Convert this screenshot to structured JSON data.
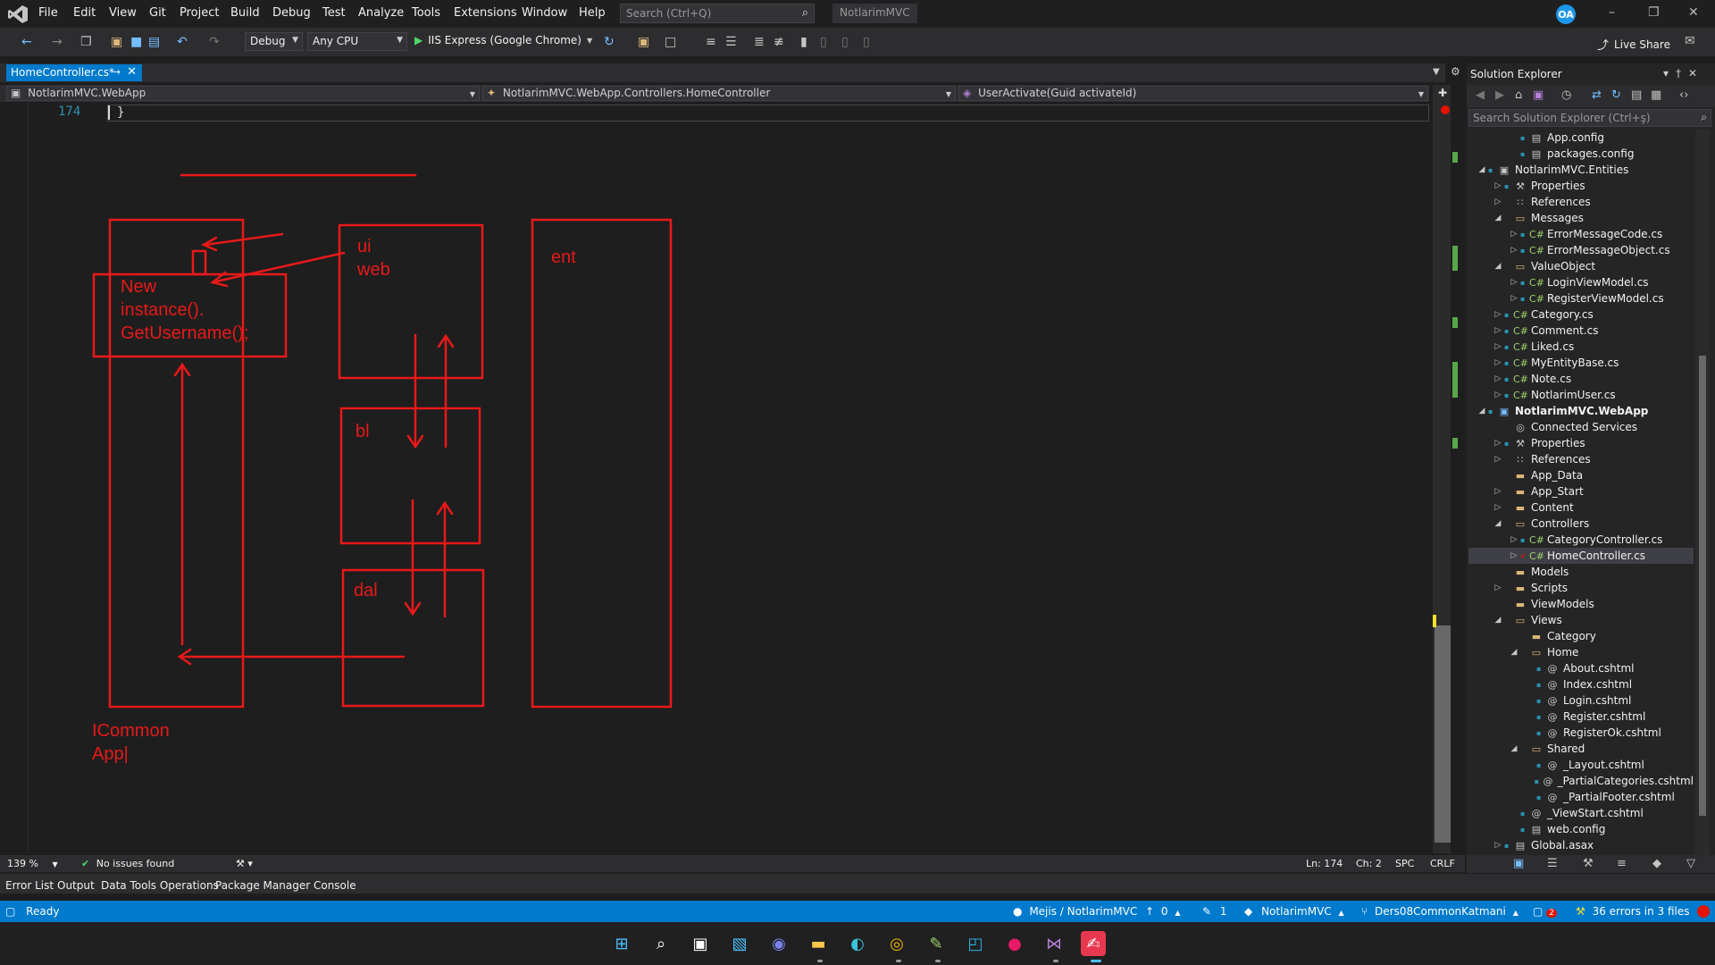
{
  "titlebar": {
    "menu": [
      "File",
      "Edit",
      "View",
      "Git",
      "Project",
      "Build",
      "Debug",
      "Test",
      "Analyze",
      "Tools",
      "Extensions",
      "Window",
      "Help"
    ],
    "search_placeholder": "Search (Ctrl+Q)",
    "solution_name": "NotlarimMVC",
    "avatar_initials": "OA"
  },
  "toolbar": {
    "configuration": "Debug",
    "platform": "Any CPU",
    "run_target": "IIS Express (Google Chrome)",
    "live_share": "Live Share"
  },
  "document_tab": {
    "label": "HomeController.cs*"
  },
  "navbar": {
    "project": "NotlarimMVC.WebApp",
    "type": "NotlarimMVC.WebApp.Controllers.HomeController",
    "member": "UserActivate(Guid activateId)"
  },
  "editor": {
    "line_number": "174",
    "code": "}"
  },
  "drawing": {
    "labels": {
      "ui": "ui",
      "web": "web",
      "ent": "ent",
      "bl": "bl",
      "dal": "dal",
      "new_line1": "New",
      "new_line2": "instance().",
      "new_line3": "GetUsername();",
      "common_line1": "ICommon",
      "common_line2": "App|"
    },
    "ink_color": "#e81919"
  },
  "solution_explorer": {
    "title": "Solution Explorer",
    "search_placeholder": "Search Solution Explorer (Ctrl+ş)",
    "items": [
      {
        "label": "App.config",
        "indent": 2,
        "expander": "",
        "icon": "config",
        "lock": true
      },
      {
        "label": "packages.config",
        "indent": 2,
        "expander": "",
        "icon": "config",
        "lock": true
      },
      {
        "label": "NotlarimMVC.Entities",
        "indent": 0,
        "expander": "open",
        "icon": "project",
        "lock": true
      },
      {
        "label": "Properties",
        "indent": 1,
        "expander": "closed",
        "icon": "wrench",
        "lock": true
      },
      {
        "label": "References",
        "indent": 1,
        "expander": "closed",
        "icon": "references",
        "lock": false
      },
      {
        "label": "Messages",
        "indent": 1,
        "expander": "open",
        "icon": "folder-open",
        "lock": false
      },
      {
        "label": "ErrorMessageCode.cs",
        "indent": 2,
        "expander": "closed",
        "icon": "csharp",
        "lock": true
      },
      {
        "label": "ErrorMessageObject.cs",
        "indent": 2,
        "expander": "closed",
        "icon": "csharp",
        "lock": true
      },
      {
        "label": "ValueObject",
        "indent": 1,
        "expander": "open",
        "icon": "folder-open",
        "lock": false
      },
      {
        "label": "LoginViewModel.cs",
        "indent": 2,
        "expander": "closed",
        "icon": "csharp",
        "lock": true
      },
      {
        "label": "RegisterViewModel.cs",
        "indent": 2,
        "expander": "closed",
        "icon": "csharp",
        "lock": true
      },
      {
        "label": "Category.cs",
        "indent": 1,
        "expander": "closed",
        "icon": "csharp",
        "lock": true
      },
      {
        "label": "Comment.cs",
        "indent": 1,
        "expander": "closed",
        "icon": "csharp",
        "lock": true
      },
      {
        "label": "Liked.cs",
        "indent": 1,
        "expander": "closed",
        "icon": "csharp",
        "lock": true
      },
      {
        "label": "MyEntityBase.cs",
        "indent": 1,
        "expander": "closed",
        "icon": "csharp",
        "lock": true
      },
      {
        "label": "Note.cs",
        "indent": 1,
        "expander": "closed",
        "icon": "csharp",
        "lock": true
      },
      {
        "label": "NotlarimUser.cs",
        "indent": 1,
        "expander": "closed",
        "icon": "csharp",
        "lock": true
      },
      {
        "label": "NotlarimMVC.WebApp",
        "indent": 0,
        "expander": "open",
        "icon": "web-project",
        "lock": true,
        "bold": true
      },
      {
        "label": "Connected Services",
        "indent": 1,
        "expander": "",
        "icon": "services",
        "lock": false
      },
      {
        "label": "Properties",
        "indent": 1,
        "expander": "closed",
        "icon": "wrench",
        "lock": true
      },
      {
        "label": "References",
        "indent": 1,
        "expander": "closed",
        "icon": "references",
        "lock": false
      },
      {
        "label": "App_Data",
        "indent": 1,
        "expander": "",
        "icon": "folder",
        "lock": false
      },
      {
        "label": "App_Start",
        "indent": 1,
        "expander": "closed",
        "icon": "folder",
        "lock": false
      },
      {
        "label": "Content",
        "indent": 1,
        "expander": "closed",
        "icon": "folder",
        "lock": false
      },
      {
        "label": "Controllers",
        "indent": 1,
        "expander": "open",
        "icon": "folder-open",
        "lock": false
      },
      {
        "label": "CategoryController.cs",
        "indent": 2,
        "expander": "closed",
        "icon": "csharp",
        "lock": true
      },
      {
        "label": "HomeController.cs",
        "indent": 2,
        "expander": "closed",
        "icon": "csharp",
        "lock": false,
        "modified": true,
        "selected": true
      },
      {
        "label": "Models",
        "indent": 1,
        "expander": "",
        "icon": "folder",
        "lock": false
      },
      {
        "label": "Scripts",
        "indent": 1,
        "expander": "closed",
        "icon": "folder",
        "lock": false
      },
      {
        "label": "ViewModels",
        "indent": 1,
        "expander": "",
        "icon": "folder",
        "lock": false
      },
      {
        "label": "Views",
        "indent": 1,
        "expander": "open",
        "icon": "folder-open",
        "lock": false
      },
      {
        "label": "Category",
        "indent": 2,
        "expander": "",
        "icon": "folder",
        "lock": false
      },
      {
        "label": "Home",
        "indent": 2,
        "expander": "open",
        "icon": "folder-open",
        "lock": false
      },
      {
        "label": "About.cshtml",
        "indent": 3,
        "expander": "",
        "icon": "razor",
        "lock": true
      },
      {
        "label": "Index.cshtml",
        "indent": 3,
        "expander": "",
        "icon": "razor",
        "lock": true
      },
      {
        "label": "Login.cshtml",
        "indent": 3,
        "expander": "",
        "icon": "razor",
        "lock": true
      },
      {
        "label": "Register.cshtml",
        "indent": 3,
        "expander": "",
        "icon": "razor",
        "lock": true
      },
      {
        "label": "RegisterOk.cshtml",
        "indent": 3,
        "expander": "",
        "icon": "razor",
        "lock": true
      },
      {
        "label": "Shared",
        "indent": 2,
        "expander": "open",
        "icon": "folder-open",
        "lock": false
      },
      {
        "label": "_Layout.cshtml",
        "indent": 3,
        "expander": "",
        "icon": "razor",
        "lock": true
      },
      {
        "label": "_PartialCategories.cshtml",
        "indent": 3,
        "expander": "",
        "icon": "razor",
        "lock": true
      },
      {
        "label": "_PartialFooter.cshtml",
        "indent": 3,
        "expander": "",
        "icon": "razor",
        "lock": true
      },
      {
        "label": "_ViewStart.cshtml",
        "indent": 2,
        "expander": "",
        "icon": "razor",
        "lock": true
      },
      {
        "label": "web.config",
        "indent": 2,
        "expander": "",
        "icon": "config",
        "lock": true
      },
      {
        "label": "Global.asax",
        "indent": 1,
        "expander": "closed",
        "icon": "config",
        "lock": true
      }
    ]
  },
  "editor_status": {
    "zoom": "139 %",
    "issues": "No issues found",
    "line": "Ln: 174",
    "col": "Ch: 2",
    "whitespace": "SPC",
    "line_endings": "CRLF"
  },
  "bottom_tabs": [
    "Error List",
    "Output",
    "Data Tools Operations",
    "Package Manager Console"
  ],
  "statusbar": {
    "ready": "Ready",
    "repo": "Mejis / NotlarimMVC",
    "up_count": "0",
    "pencil_count": "1",
    "project": "NotlarimMVC",
    "branch": "Ders08CommonKatmani",
    "notif_count": "2",
    "errors": "36 errors in 3 files"
  },
  "colors": {
    "accent": "#007acc",
    "ink": "#e81919",
    "editor_bg": "#1e1e1e"
  }
}
